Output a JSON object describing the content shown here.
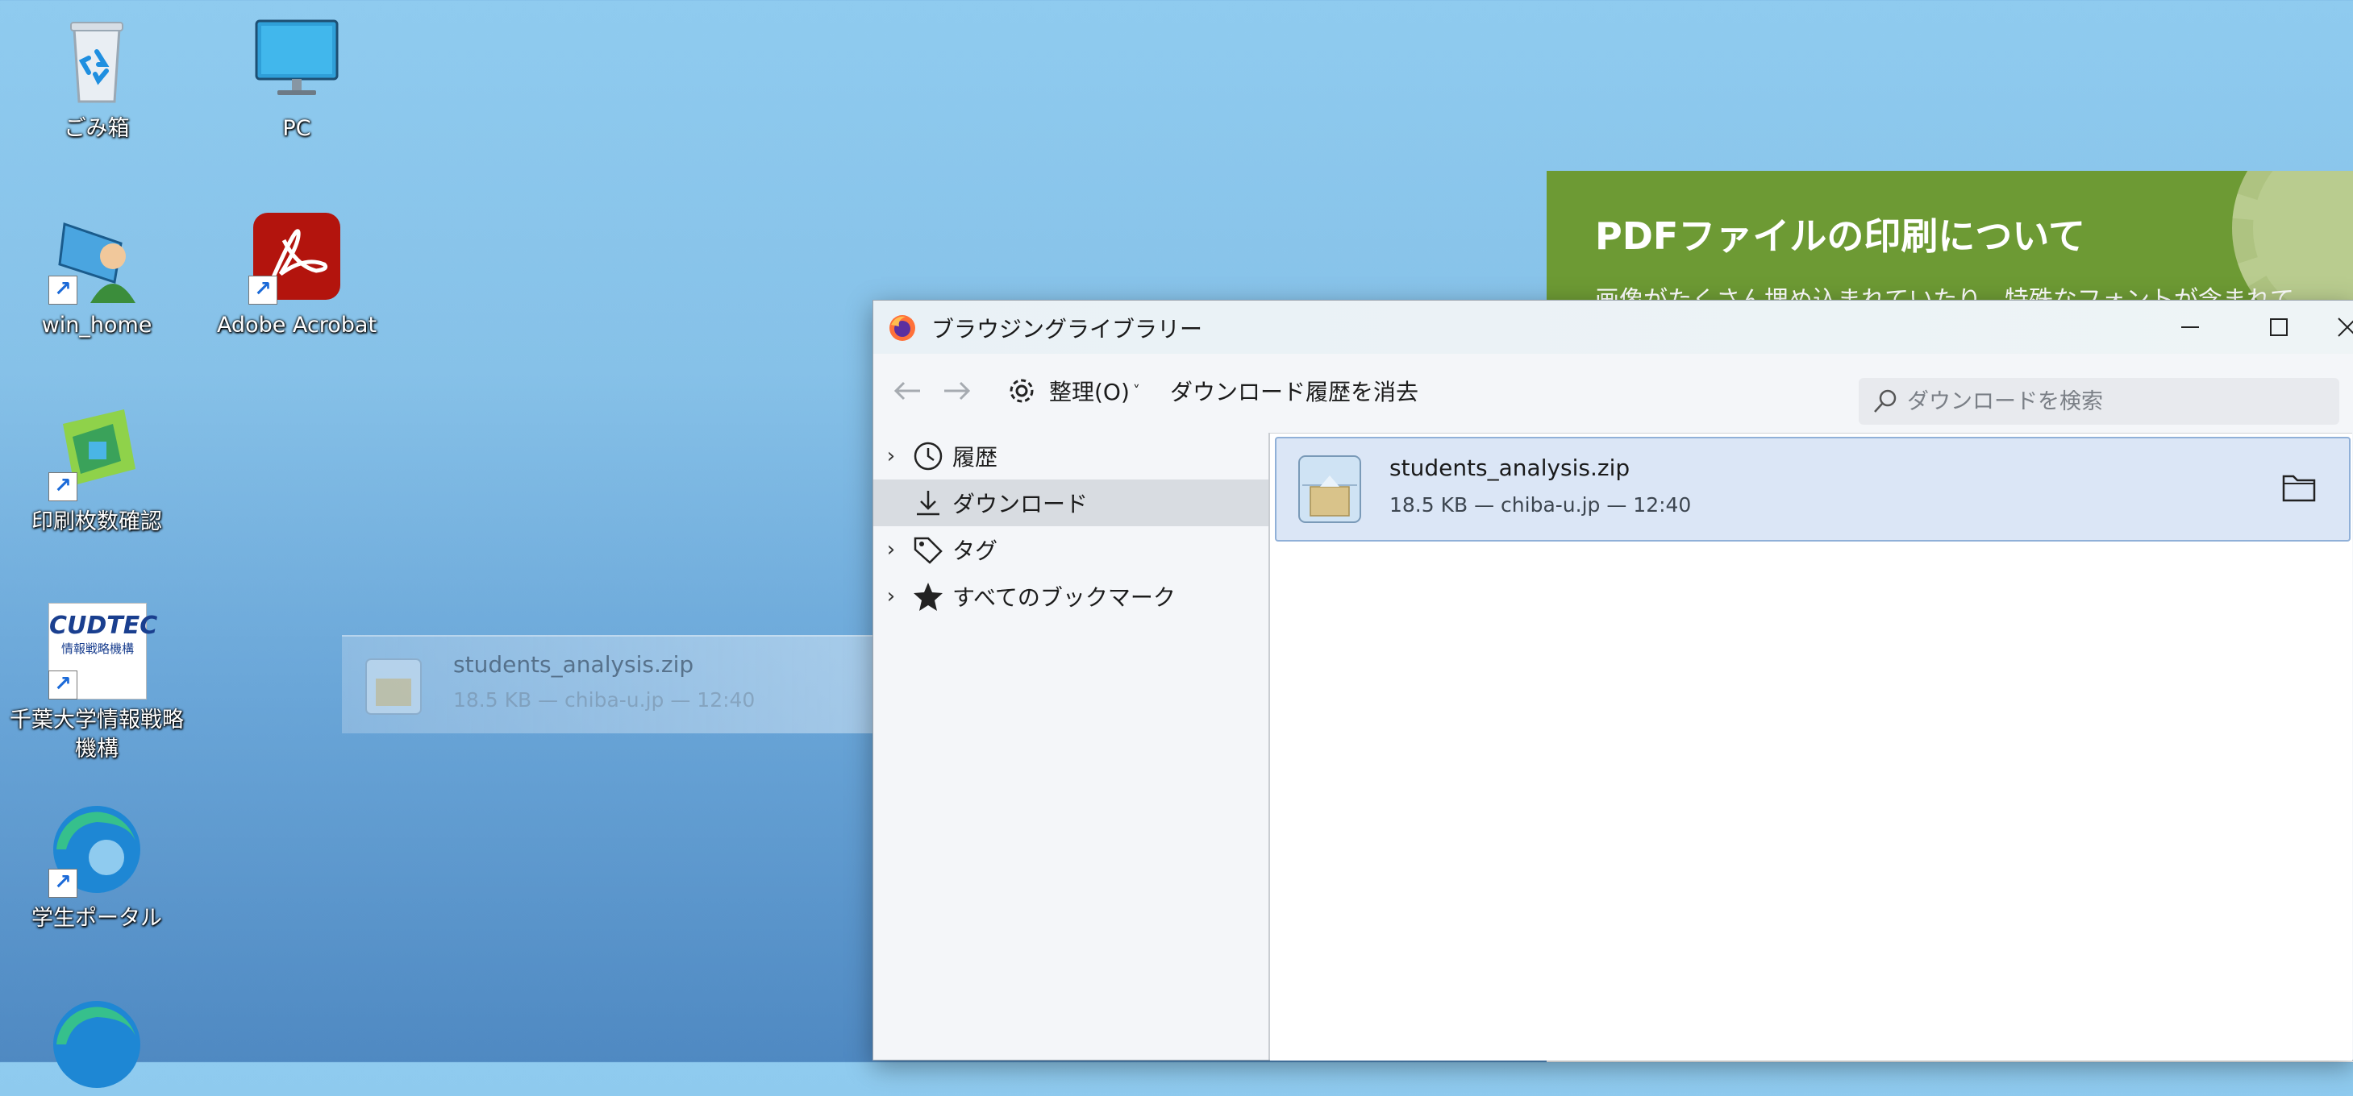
{
  "desktop": {
    "icons": [
      {
        "label": "ごみ箱",
        "icon": "recycle-bin-icon"
      },
      {
        "label": "PC",
        "icon": "monitor-icon"
      },
      {
        "label": "win_home",
        "icon": "remote-desktop-icon"
      },
      {
        "label": "Adobe Acrobat",
        "icon": "acrobat-icon"
      },
      {
        "label": "印刷枚数確認",
        "icon": "print-count-icon"
      },
      {
        "label": "千葉大学情報戦略機構",
        "icon": "cudtec-icon",
        "logo_text": "CUDTEC",
        "logo_sub": "情報戦略機構"
      },
      {
        "label": "学生ポータル",
        "icon": "edge-icon"
      }
    ]
  },
  "webpage": {
    "title": "PDFファイルの印刷について",
    "subtitle": "画像がたくさん埋め込まれていたり、特殊なフォントが含まれて"
  },
  "drag_ghost": {
    "name": "students_analysis.zip",
    "meta": "18.5 KB — chiba-u.jp — 12:40"
  },
  "window": {
    "title": "ブラウジングライブラリー",
    "toolbar": {
      "organize_label": "整理(O)",
      "clear_history_label": "ダウンロード履歴を消去",
      "search_placeholder": "ダウンロードを検索"
    },
    "sidebar": [
      {
        "label": "履歴",
        "icon": "clock-icon",
        "expandable": true,
        "selected": false
      },
      {
        "label": "ダウンロード",
        "icon": "download-icon",
        "expandable": false,
        "selected": true
      },
      {
        "label": "タグ",
        "icon": "tag-icon",
        "expandable": true,
        "selected": false
      },
      {
        "label": "すべてのブックマーク",
        "icon": "star-icon",
        "expandable": true,
        "selected": false
      }
    ],
    "downloads": [
      {
        "name": "students_analysis.zip",
        "meta": "18.5 KB — chiba-u.jp — 12:40"
      }
    ]
  }
}
